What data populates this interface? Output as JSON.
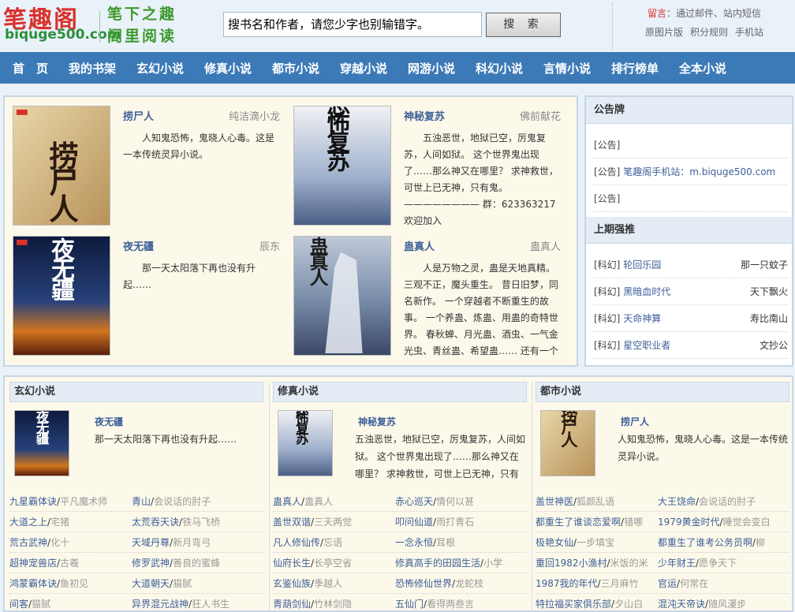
{
  "header": {
    "logo_text": "笔趣阁",
    "logo_domain": "biquge500.com",
    "slogan_line1": "笔下之趣",
    "slogan_line2": "阁里阅读",
    "search_value": "搜书名和作者，请您少字也别输错字。",
    "search_button": "搜 索",
    "message_label": "留言",
    "message_text": "：通过邮件、站内短信",
    "links": [
      "原图片版",
      "积分规则",
      "手机站"
    ]
  },
  "nav": [
    "首　页",
    "我的书架",
    "玄幻小说",
    "修真小说",
    "都市小说",
    "穿越小说",
    "网游小说",
    "科幻小说",
    "言情小说",
    "排行榜单",
    "全本小说"
  ],
  "featured": [
    {
      "title": "捞尸人",
      "author": "纯洁滴小龙",
      "cover_text": "捞尸人",
      "desc": "人知鬼恐怖，鬼晓人心毒。这是一本传统灵异小说。"
    },
    {
      "title": "神秘复苏",
      "author": "佛前献花",
      "cover_text": "恐怖复苏",
      "desc": "五浊恶世，地狱已空，厉鬼复苏，人间如狱。 这个世界鬼出现了……那么神又在哪里？ 求神救世，可世上已无神，只有鬼。 ———————— 群：623363217 欢迎加入"
    },
    {
      "title": "夜无疆",
      "author": "辰东",
      "cover_text": "夜无疆",
      "desc": "那一天太阳落下再也没有升起……"
    },
    {
      "title": "蛊真人",
      "author": "蛊真人",
      "cover_text": "蛊真人",
      "desc": "人是万物之灵，蛊是天地真精。 三观不正，魔头重生。 昔日旧梦，同名新作。 一个穿越者不断重生的故事。 一个养蛊、炼蛊、用蛊的奇特世界。 春秋蝉、月光蛊、酒虫、一气金光虫、青丝蛊、希望蛊…… 还有一个"
    }
  ],
  "sidebar": {
    "notice_title": "公告牌",
    "notices": [
      {
        "tag": "[公告]",
        "text": ""
      },
      {
        "tag": "[公告]",
        "text": "笔趣阁手机站：m.biquge500.com"
      },
      {
        "tag": "[公告]",
        "text": ""
      }
    ],
    "rank_title": "上期强推",
    "ranks": [
      {
        "tag": "[科幻]",
        "title": "轮回乐园",
        "author": "那一只蚊子"
      },
      {
        "tag": "[科幻]",
        "title": "黑暗血时代",
        "author": "天下飘火"
      },
      {
        "tag": "[科幻]",
        "title": "天命神算",
        "author": "寿比南山"
      },
      {
        "tag": "[科幻]",
        "title": "星空职业者",
        "author": "文抄公"
      }
    ]
  },
  "categories": [
    {
      "name": "玄幻小说",
      "top": {
        "title": "夜无疆",
        "cover_text": "夜无疆",
        "desc": "那一天太阳落下再也没有升起……"
      },
      "rows": [
        [
          {
            "title": "九星霸体诀",
            "author": "平凡魔术师"
          },
          {
            "title": "青山",
            "author": "会说话的肘子"
          }
        ],
        [
          {
            "title": "大道之上",
            "author": "宅猪"
          },
          {
            "title": "太荒吞天诀",
            "author": "铁马飞桥"
          }
        ],
        [
          {
            "title": "荒古武神",
            "author": "化十"
          },
          {
            "title": "天域丹尊",
            "author": "新月弯弓"
          }
        ],
        [
          {
            "title": "超神宠兽店",
            "author": "古羲"
          },
          {
            "title": "修罗武神",
            "author": "善良的蜜蜂"
          }
        ],
        [
          {
            "title": "鸿蒙霸体诀",
            "author": "鱼初见"
          },
          {
            "title": "大道朝天",
            "author": "猫腻"
          }
        ],
        [
          {
            "title": "间客",
            "author": "猫腻"
          },
          {
            "title": "异界混元战神",
            "author": "狂人书生"
          }
        ]
      ]
    },
    {
      "name": "修真小说",
      "top": {
        "title": "神秘复苏",
        "cover_text": "恐怖复苏",
        "desc": "五浊恶世，地狱已空，厉鬼复苏，人间如狱。 这个世界鬼出现了……那么神又在哪里？ 求神救世，可世上已无神，只有"
      },
      "rows": [
        [
          {
            "title": "蛊真人",
            "author": "蛊真人"
          },
          {
            "title": "赤心巡天",
            "author": "情何以甚"
          }
        ],
        [
          {
            "title": "盖世双谐",
            "author": "三天两觉"
          },
          {
            "title": "叩问仙道",
            "author": "雨打青石"
          }
        ],
        [
          {
            "title": "凡人修仙传",
            "author": "忘语"
          },
          {
            "title": "一念永恒",
            "author": "耳根"
          }
        ],
        [
          {
            "title": "仙府长生",
            "author": "长亭空省"
          },
          {
            "title": "修真高手的田园生活",
            "author": "小学"
          }
        ],
        [
          {
            "title": "玄鉴仙族",
            "author": "季越人"
          },
          {
            "title": "恐怖修仙世界",
            "author": "龙蛇枝"
          }
        ],
        [
          {
            "title": "青葫剑仙",
            "author": "竹林剑隐"
          },
          {
            "title": "五仙门",
            "author": "看得两叁言"
          }
        ]
      ]
    },
    {
      "name": "都市小说",
      "top": {
        "title": "捞尸人",
        "cover_text": "捞尸人",
        "desc": "人知鬼恐怖，鬼晓人心毒。这是一本传统灵异小说。"
      },
      "rows": [
        [
          {
            "title": "盖世神医",
            "author": "狐颜乱语"
          },
          {
            "title": "大王饶命",
            "author": "会说话的肘子"
          }
        ],
        [
          {
            "title": "都重生了谁谈恋爱啊",
            "author": "错哪"
          },
          {
            "title": "1979黄金时代",
            "author": "睡觉会变白"
          }
        ],
        [
          {
            "title": "极艳女仙",
            "author": "一步填宝"
          },
          {
            "title": "都重生了谁考公务员啊",
            "author": "柳"
          }
        ],
        [
          {
            "title": "重回1982小渔村",
            "author": "米饭的米"
          },
          {
            "title": "少年财王",
            "author": "愿争天下"
          }
        ],
        [
          {
            "title": "1987我的年代",
            "author": "三月麻竹"
          },
          {
            "title": "官运",
            "author": "何常在"
          }
        ],
        [
          {
            "title": "特拉福买家俱乐部",
            "author": "夕山白"
          },
          {
            "title": "混沌天帝诀",
            "author": "随风漫步"
          }
        ]
      ]
    }
  ],
  "colors": {
    "nav_bg": "#3c7ab7",
    "logo_red": "#d9322b",
    "link_blue": "#3d5f99",
    "panel_bg": "#fdf9ea",
    "page_bg": "#e9f1f9"
  }
}
